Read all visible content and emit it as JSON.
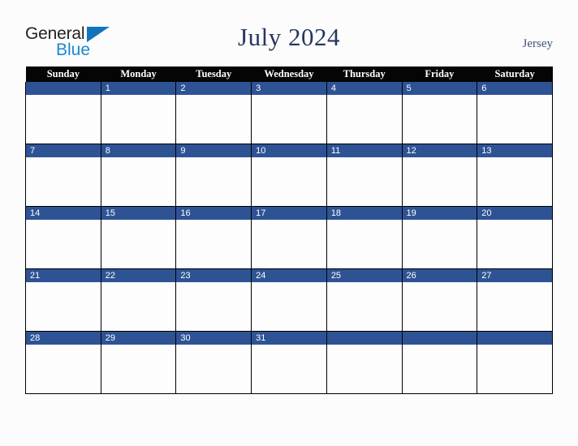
{
  "brand": {
    "name_part1": "General",
    "name_part2": "Blue",
    "triangle_icon": "triangle-icon",
    "colors": {
      "general_text": "#231f20",
      "blue_text": "#1b87d2",
      "triangle": "#1274bc"
    }
  },
  "header": {
    "title": "July 2024",
    "region": "Jersey",
    "title_color": "#24385f",
    "region_color": "#3c5076"
  },
  "calendar": {
    "month": "July",
    "year": "2024",
    "weekday_headers": [
      "Sunday",
      "Monday",
      "Tuesday",
      "Wednesday",
      "Thursday",
      "Friday",
      "Saturday"
    ],
    "header_bg": "#050505",
    "header_text_color": "#ffffff",
    "daynum_bg": "#2e5395",
    "daynum_text_color": "#ffffff",
    "cell_bg": "#fdfdfd",
    "grid_line_color": "#000000",
    "weeks": [
      [
        "",
        "1",
        "2",
        "3",
        "4",
        "5",
        "6"
      ],
      [
        "7",
        "8",
        "9",
        "10",
        "11",
        "12",
        "13"
      ],
      [
        "14",
        "15",
        "16",
        "17",
        "18",
        "19",
        "20"
      ],
      [
        "21",
        "22",
        "23",
        "24",
        "25",
        "26",
        "27"
      ],
      [
        "28",
        "29",
        "30",
        "31",
        "",
        "",
        ""
      ]
    ]
  },
  "page": {
    "background": "#fcfcfd"
  }
}
